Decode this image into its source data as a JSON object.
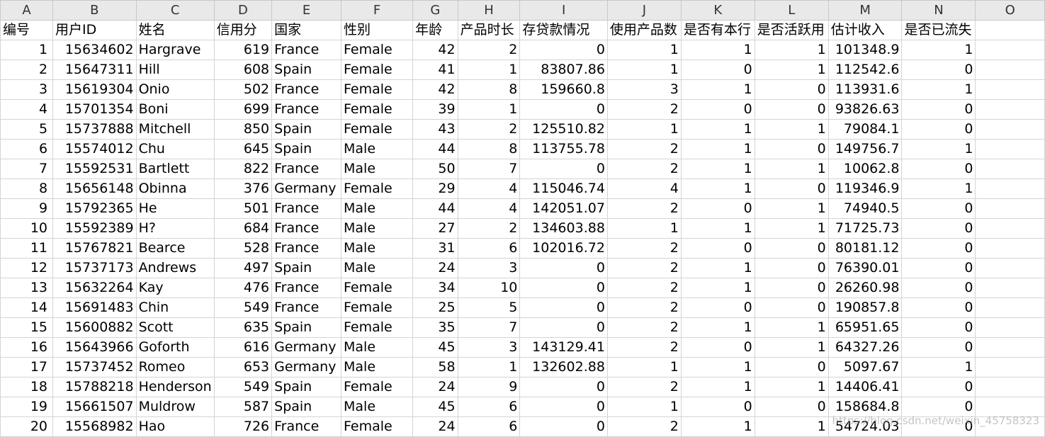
{
  "columns": [
    "A",
    "B",
    "C",
    "D",
    "E",
    "F",
    "G",
    "H",
    "I",
    "J",
    "K",
    "L",
    "M",
    "N",
    "O"
  ],
  "numeric_columns": [
    0,
    1,
    3,
    6,
    7,
    8,
    9,
    10,
    11,
    12,
    13
  ],
  "headers": [
    "编号",
    "用户ID",
    "姓名",
    "信用分",
    "国家",
    "性别",
    "年龄",
    "产品时长",
    "存贷款情况",
    "使用产品数",
    "是否有本行",
    "是否活跃用",
    "估计收入",
    "是否已流失",
    ""
  ],
  "rows": [
    [
      "1",
      "15634602",
      "Hargrave",
      "619",
      "France",
      "Female",
      "42",
      "2",
      "0",
      "1",
      "1",
      "1",
      "101348.9",
      "1",
      ""
    ],
    [
      "2",
      "15647311",
      "Hill",
      "608",
      "Spain",
      "Female",
      "41",
      "1",
      "83807.86",
      "1",
      "0",
      "1",
      "112542.6",
      "0",
      ""
    ],
    [
      "3",
      "15619304",
      "Onio",
      "502",
      "France",
      "Female",
      "42",
      "8",
      "159660.8",
      "3",
      "1",
      "0",
      "113931.6",
      "1",
      ""
    ],
    [
      "4",
      "15701354",
      "Boni",
      "699",
      "France",
      "Female",
      "39",
      "1",
      "0",
      "2",
      "0",
      "0",
      "93826.63",
      "0",
      ""
    ],
    [
      "5",
      "15737888",
      "Mitchell",
      "850",
      "Spain",
      "Female",
      "43",
      "2",
      "125510.82",
      "1",
      "1",
      "1",
      "79084.1",
      "0",
      ""
    ],
    [
      "6",
      "15574012",
      "Chu",
      "645",
      "Spain",
      "Male",
      "44",
      "8",
      "113755.78",
      "2",
      "1",
      "0",
      "149756.7",
      "1",
      ""
    ],
    [
      "7",
      "15592531",
      "Bartlett",
      "822",
      "France",
      "Male",
      "50",
      "7",
      "0",
      "2",
      "1",
      "1",
      "10062.8",
      "0",
      ""
    ],
    [
      "8",
      "15656148",
      "Obinna",
      "376",
      "Germany",
      "Female",
      "29",
      "4",
      "115046.74",
      "4",
      "1",
      "0",
      "119346.9",
      "1",
      ""
    ],
    [
      "9",
      "15792365",
      "He",
      "501",
      "France",
      "Male",
      "44",
      "4",
      "142051.07",
      "2",
      "0",
      "1",
      "74940.5",
      "0",
      ""
    ],
    [
      "10",
      "15592389",
      "H?",
      "684",
      "France",
      "Male",
      "27",
      "2",
      "134603.88",
      "1",
      "1",
      "1",
      "71725.73",
      "0",
      ""
    ],
    [
      "11",
      "15767821",
      "Bearce",
      "528",
      "France",
      "Male",
      "31",
      "6",
      "102016.72",
      "2",
      "0",
      "0",
      "80181.12",
      "0",
      ""
    ],
    [
      "12",
      "15737173",
      "Andrews",
      "497",
      "Spain",
      "Male",
      "24",
      "3",
      "0",
      "2",
      "1",
      "0",
      "76390.01",
      "0",
      ""
    ],
    [
      "13",
      "15632264",
      "Kay",
      "476",
      "France",
      "Female",
      "34",
      "10",
      "0",
      "2",
      "1",
      "0",
      "26260.98",
      "0",
      ""
    ],
    [
      "14",
      "15691483",
      "Chin",
      "549",
      "France",
      "Female",
      "25",
      "5",
      "0",
      "2",
      "0",
      "0",
      "190857.8",
      "0",
      ""
    ],
    [
      "15",
      "15600882",
      "Scott",
      "635",
      "Spain",
      "Female",
      "35",
      "7",
      "0",
      "2",
      "1",
      "1",
      "65951.65",
      "0",
      ""
    ],
    [
      "16",
      "15643966",
      "Goforth",
      "616",
      "Germany",
      "Male",
      "45",
      "3",
      "143129.41",
      "2",
      "0",
      "1",
      "64327.26",
      "0",
      ""
    ],
    [
      "17",
      "15737452",
      "Romeo",
      "653",
      "Germany",
      "Male",
      "58",
      "1",
      "132602.88",
      "1",
      "1",
      "0",
      "5097.67",
      "1",
      ""
    ],
    [
      "18",
      "15788218",
      "Henderson",
      "549",
      "Spain",
      "Female",
      "24",
      "9",
      "0",
      "2",
      "1",
      "1",
      "14406.41",
      "0",
      ""
    ],
    [
      "19",
      "15661507",
      "Muldrow",
      "587",
      "Spain",
      "Male",
      "45",
      "6",
      "0",
      "1",
      "0",
      "0",
      "158684.8",
      "0",
      ""
    ],
    [
      "20",
      "15568982",
      "Hao",
      "726",
      "France",
      "Female",
      "24",
      "6",
      "0",
      "2",
      "1",
      "1",
      "54724.03",
      "0",
      ""
    ]
  ],
  "watermark": "https://blog.csdn.net/weixin_45758323"
}
